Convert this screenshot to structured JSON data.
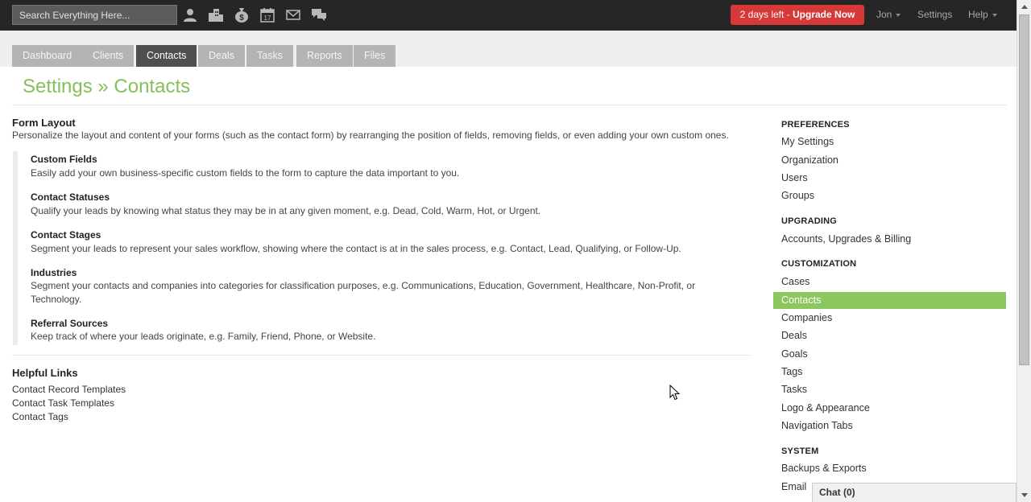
{
  "topbar": {
    "search_placeholder": "Search Everything Here...",
    "icons": [
      "person-icon",
      "building-icon",
      "money-bag-icon",
      "calendar-icon",
      "envelope-icon",
      "chat-bubbles-icon"
    ],
    "calendar_day": "17",
    "upgrade_days": "2 days left - ",
    "upgrade_label": "Upgrade Now",
    "user": "Jon",
    "settings": "Settings",
    "help": "Help"
  },
  "tabs": [
    "Dashboard",
    "Clients",
    "Contacts",
    "Deals",
    "Tasks",
    "Reports",
    "Files"
  ],
  "active_tab": "Contacts",
  "page_title": "Settings » Contacts",
  "form_layout": {
    "title": "Form Layout",
    "description": "Personalize the layout and content of your forms (such as the contact form) by rearranging the position of fields, removing fields, or even adding your own custom ones.",
    "items": [
      {
        "title": "Custom Fields",
        "desc": "Easily add your own business-specific custom fields to the form to capture the data important to you."
      },
      {
        "title": "Contact Statuses",
        "desc": "Qualify your leads by knowing what status they may be in at any given moment, e.g. Dead, Cold, Warm, Hot, or Urgent."
      },
      {
        "title": "Contact Stages",
        "desc": "Segment your leads to represent your sales workflow, showing where the contact is at in the sales process, e.g. Contact, Lead, Qualifying, or Follow-Up."
      },
      {
        "title": "Industries",
        "desc": "Segment your contacts and companies into categories for classification purposes, e.g. Communications, Education, Government, Healthcare, Non-Profit, or Technology."
      },
      {
        "title": "Referral Sources",
        "desc": "Keep track of where your leads originate, e.g. Family, Friend, Phone, or Website."
      }
    ]
  },
  "helpful_links": {
    "title": "Helpful Links",
    "links": [
      "Contact Record Templates",
      "Contact Task Templates",
      "Contact Tags"
    ]
  },
  "sidebar": {
    "preferences": {
      "heading": "PREFERENCES",
      "items": [
        "My Settings",
        "Organization",
        "Users",
        "Groups"
      ]
    },
    "upgrading": {
      "heading": "UPGRADING",
      "items": [
        "Accounts, Upgrades & Billing"
      ]
    },
    "customization": {
      "heading": "CUSTOMIZATION",
      "items": [
        "Cases",
        "Contacts",
        "Companies",
        "Deals",
        "Goals",
        "Tags",
        "Tasks",
        "Logo & Appearance",
        "Navigation Tabs"
      ]
    },
    "system": {
      "heading": "SYSTEM",
      "items": [
        "Backups & Exports",
        "Email"
      ]
    },
    "active_item": "Contacts"
  },
  "chat": {
    "label": "Chat (0)"
  },
  "colors": {
    "accent_green": "#85c05a",
    "upgrade_red": "#d73838",
    "topbar": "#262626"
  }
}
